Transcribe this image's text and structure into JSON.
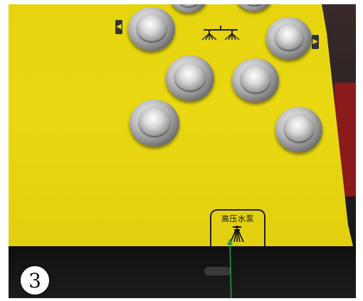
{
  "panel": {
    "label": "高压水泵",
    "color": "#e6d40e"
  },
  "badge": {
    "number": "3"
  },
  "icons": {
    "pump": "high-pressure-pump-icon",
    "sprinkler": "sprinkler-bar-icon",
    "left_arrow": "left-arrow-icon",
    "right_arrow": "right-arrow-icon"
  },
  "pointer_color": "#1f9e4a"
}
